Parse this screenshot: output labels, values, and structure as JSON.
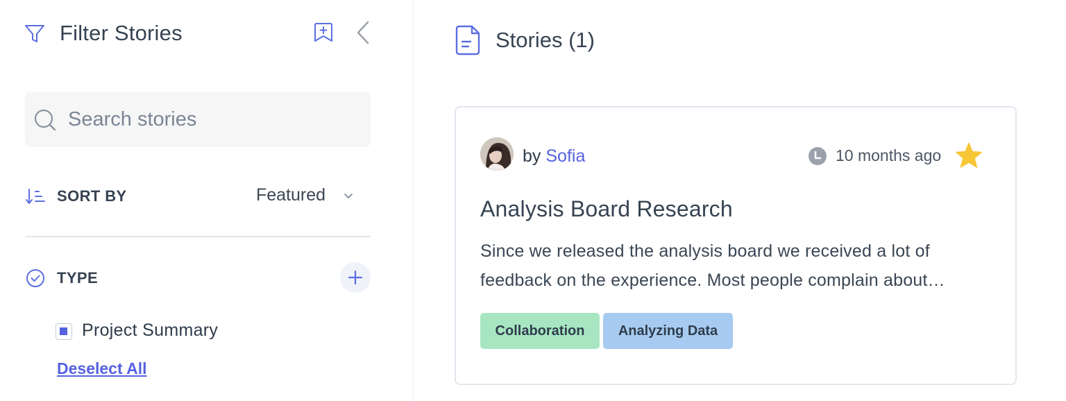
{
  "sidebar": {
    "title": "Filter Stories",
    "search": {
      "placeholder": "Search stories",
      "value": ""
    },
    "sort": {
      "label": "SORT BY",
      "value": "Featured"
    },
    "type_filter": {
      "label": "TYPE",
      "options": [
        {
          "label": "Project Summary",
          "checked": true
        }
      ],
      "deselect_label": "Deselect All"
    }
  },
  "main": {
    "title": "Stories (1)",
    "stories": [
      {
        "by_prefix": "by",
        "author": "Sofia",
        "time": "10 months ago",
        "starred": true,
        "title": "Analysis Board Research",
        "excerpt": "Since we released the analysis board we received a lot of feedback on the experience. Most people complain about…",
        "tags": [
          {
            "label": "Collaboration",
            "color": "#a8e6c2"
          },
          {
            "label": "Analyzing Data",
            "color": "#a7cbf0"
          }
        ]
      }
    ]
  },
  "colors": {
    "accent": "#5662e0",
    "star": "#f7c636",
    "icon_blue": "#5b6ee1",
    "clock_gray": "#9aa1ab"
  }
}
